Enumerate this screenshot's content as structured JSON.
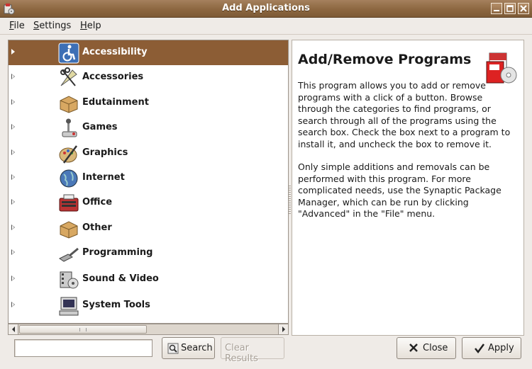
{
  "window": {
    "title": "Add Applications"
  },
  "menubar": {
    "items": [
      {
        "label": "File",
        "mnemonic": "F",
        "rest": "ile"
      },
      {
        "label": "Settings",
        "mnemonic": "S",
        "rest": "ettings"
      },
      {
        "label": "Help",
        "mnemonic": "H",
        "rest": "elp"
      }
    ]
  },
  "categories": [
    {
      "label": "Accessibility",
      "icon": "accessibility-icon",
      "selected": true
    },
    {
      "label": "Accessories",
      "icon": "accessories-icon"
    },
    {
      "label": "Edutainment",
      "icon": "edutainment-icon"
    },
    {
      "label": "Games",
      "icon": "games-icon"
    },
    {
      "label": "Graphics",
      "icon": "graphics-icon"
    },
    {
      "label": "Internet",
      "icon": "internet-icon"
    },
    {
      "label": "Office",
      "icon": "office-icon"
    },
    {
      "label": "Other",
      "icon": "other-icon"
    },
    {
      "label": "Programming",
      "icon": "programming-icon"
    },
    {
      "label": "Sound & Video",
      "icon": "sound-video-icon"
    },
    {
      "label": "System Tools",
      "icon": "system-tools-icon"
    }
  ],
  "info": {
    "title": "Add/Remove Programs",
    "paragraph1": "This program allows you to add or remove programs with a click of a button. Browse through the categories to find programs, or search through all of the programs using the search box. Check the box next to a program to install it, and uncheck the box to remove it.",
    "paragraph2": "Only simple additions and removals can be performed with this program. For more complicated needs, use the Synaptic Package Manager, which can be run by clicking \"Advanced\" in the \"File\" menu."
  },
  "search": {
    "value": "",
    "button_label": "Search",
    "clear_label": "Clear Results"
  },
  "actions": {
    "close_label": "Close",
    "apply_label": "Apply"
  },
  "colors": {
    "titlebar": "#8c6740",
    "selection": "#8c5d35",
    "window_bg": "#efebe7"
  }
}
